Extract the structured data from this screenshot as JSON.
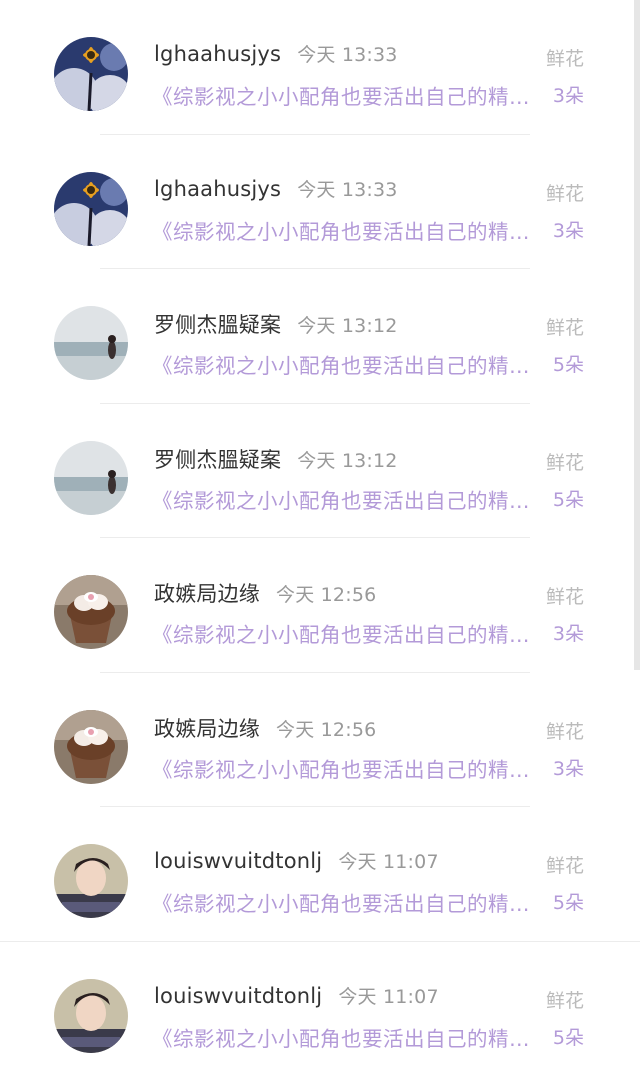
{
  "records": [
    {
      "user": "lghaahusjys",
      "time": "今天 13:33",
      "book": "《综影视之小小配角也要活出自己的精彩》",
      "gift_label": "鲜花",
      "gift_count": "3朵",
      "avatar": "sunflower"
    },
    {
      "user": "lghaahusjys",
      "time": "今天 13:33",
      "book": "《综影视之小小配角也要活出自己的精彩》",
      "gift_label": "鲜花",
      "gift_count": "3朵",
      "avatar": "sunflower"
    },
    {
      "user": "罗侧杰膃疑案",
      "time": "今天 13:12",
      "book": "《综影视之小小配角也要活出自己的精彩》",
      "gift_label": "鲜花",
      "gift_count": "5朵",
      "avatar": "seaside"
    },
    {
      "user": "罗侧杰膃疑案",
      "time": "今天 13:12",
      "book": "《综影视之小小配角也要活出自己的精彩》",
      "gift_label": "鲜花",
      "gift_count": "5朵",
      "avatar": "seaside"
    },
    {
      "user": "政嫉局边缘",
      "time": "今天 12:56",
      "book": "《综影视之小小配角也要活出自己的精彩》",
      "gift_label": "鲜花",
      "gift_count": "3朵",
      "avatar": "cupcake"
    },
    {
      "user": "政嫉局边缘",
      "time": "今天 12:56",
      "book": "《综影视之小小配角也要活出自己的精彩》",
      "gift_label": "鲜花",
      "gift_count": "3朵",
      "avatar": "cupcake"
    },
    {
      "user": "louiswvuitdtonlj",
      "time": "今天 11:07",
      "book": "《综影视之小小配角也要活出自己的精彩》",
      "gift_label": "鲜花",
      "gift_count": "5朵",
      "avatar": "portrait"
    },
    {
      "user": "louiswvuitdtonlj",
      "time": "今天 11:07",
      "book": "《综影视之小小配角也要活出自己的精彩》",
      "gift_label": "鲜花",
      "gift_count": "5朵",
      "avatar": "portrait"
    }
  ],
  "colors": {
    "title": "#b39ad8",
    "name": "#333333",
    "muted": "#999999"
  }
}
